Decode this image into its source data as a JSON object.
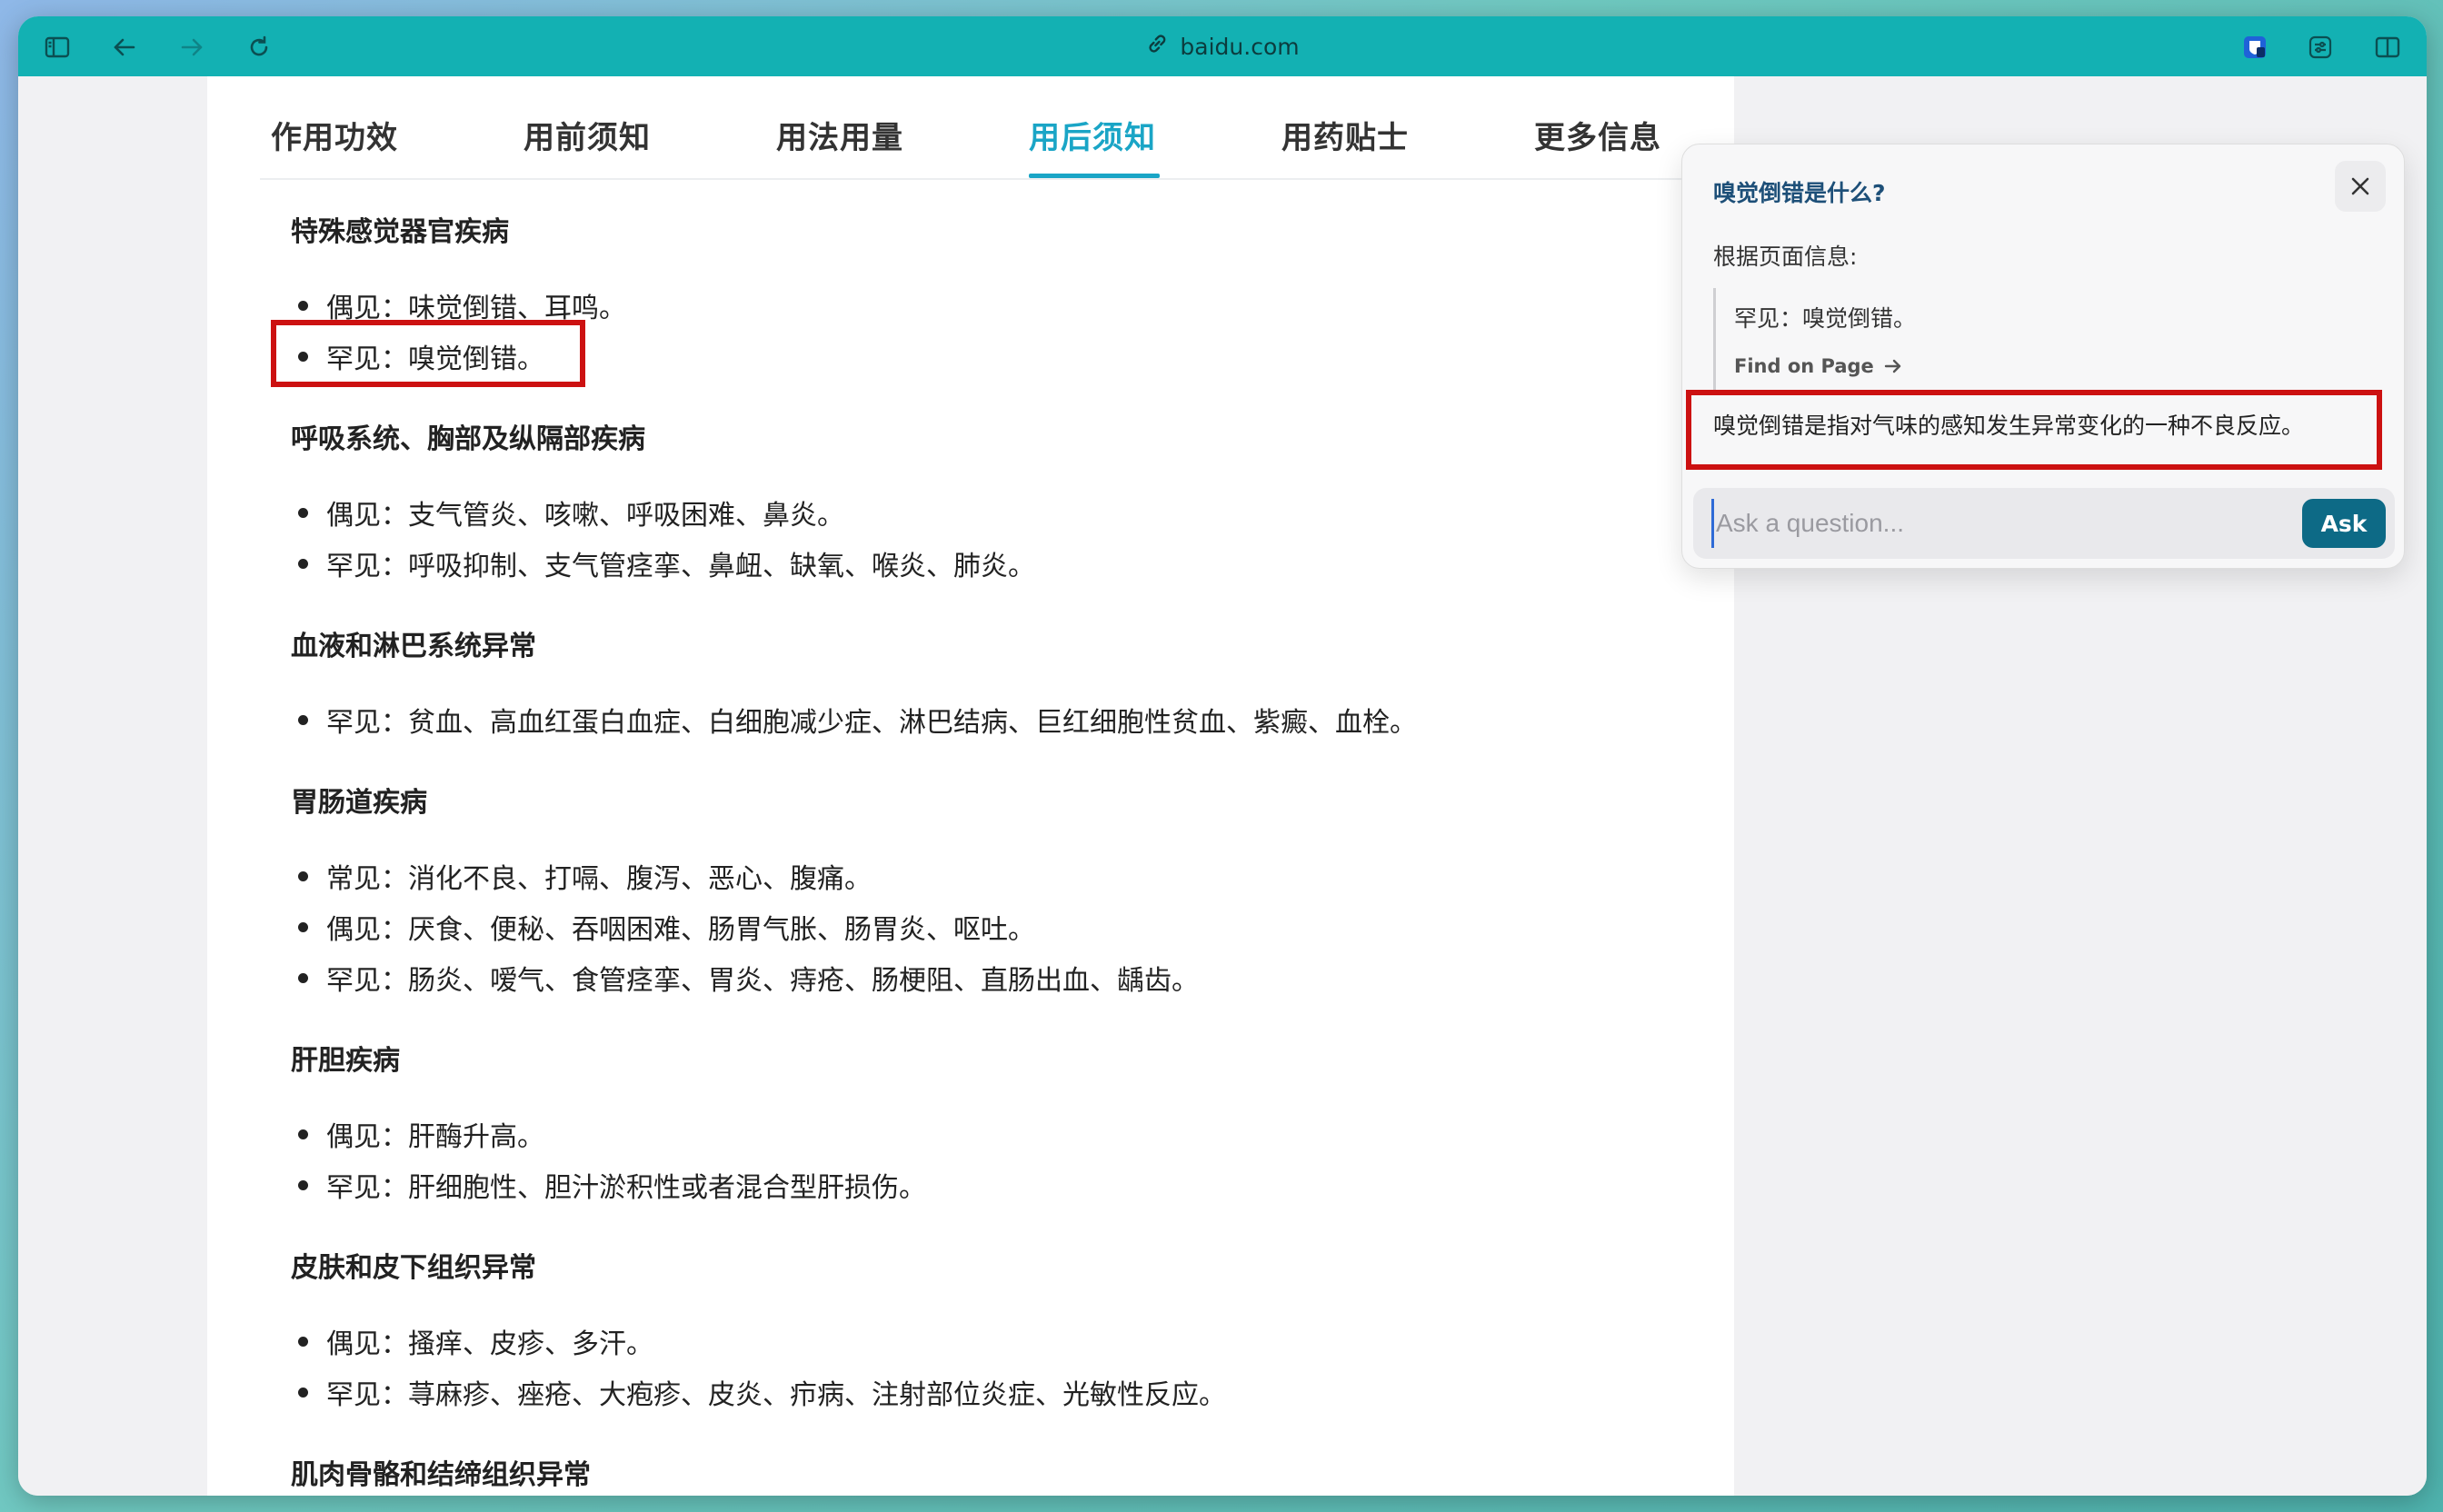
{
  "browser": {
    "address": "baidu.com",
    "icons": [
      "sidebar-icon",
      "back-icon",
      "forward-icon",
      "reload-icon",
      "link-icon",
      "bitwarden-icon",
      "extension-icon",
      "split-view-icon"
    ]
  },
  "tabs": [
    "作用功效",
    "用前须知",
    "用法用量",
    "用后须知",
    "用药贴士",
    "更多信息"
  ],
  "active_tab": "用后须知",
  "sections": [
    {
      "title": "特殊感觉器官疾病",
      "items": [
        "偶见：味觉倒错、耳鸣。",
        "罕见：嗅觉倒错。"
      ]
    },
    {
      "title": "呼吸系统、胸部及纵隔部疾病",
      "items": [
        "偶见：支气管炎、咳嗽、呼吸困难、鼻炎。",
        "罕见：呼吸抑制、支气管痉挛、鼻衄、缺氧、喉炎、肺炎。"
      ]
    },
    {
      "title": "血液和淋巴系统异常",
      "items": [
        "罕见：贫血、高血红蛋白血症、白细胞减少症、淋巴结病、巨红细胞性贫血、紫癜、血栓。"
      ]
    },
    {
      "title": "胃肠道疾病",
      "items": [
        "常见：消化不良、打嗝、腹泻、恶心、腹痛。",
        "偶见：厌食、便秘、吞咽困难、肠胃气胀、肠胃炎、呕吐。",
        "罕见：肠炎、嗳气、食管痉挛、胃炎、痔疮、肠梗阻、直肠出血、龋齿。"
      ]
    },
    {
      "title": "肝胆疾病",
      "items": [
        "偶见：肝酶升高。",
        "罕见：肝细胞性、胆汁淤积性或者混合型肝损伤。"
      ]
    },
    {
      "title": "皮肤和皮下组织异常",
      "items": [
        "偶见：搔痒、皮疹、多汗。",
        "罕见：荨麻疹、痤疮、大疱疹、皮炎、疖病、注射部位炎症、光敏性反应。"
      ]
    },
    {
      "title": "肌肉骨骼和结缔组织异常",
      "items": []
    }
  ],
  "popup": {
    "title": "嗅觉倒错是什么?",
    "sub": "根据页面信息:",
    "quote": "罕见：嗅觉倒错。",
    "find_link": "Find on Page",
    "answer": "嗅觉倒错是指对气味的感知发生异常变化的一种不良反应。",
    "input_placeholder": "Ask a question...",
    "ask_label": "Ask"
  },
  "colors": {
    "toolbar": "#13b1b3",
    "accent": "#1aa5c6",
    "highlight": "#cc1111",
    "ask_button": "#0d6a86"
  }
}
